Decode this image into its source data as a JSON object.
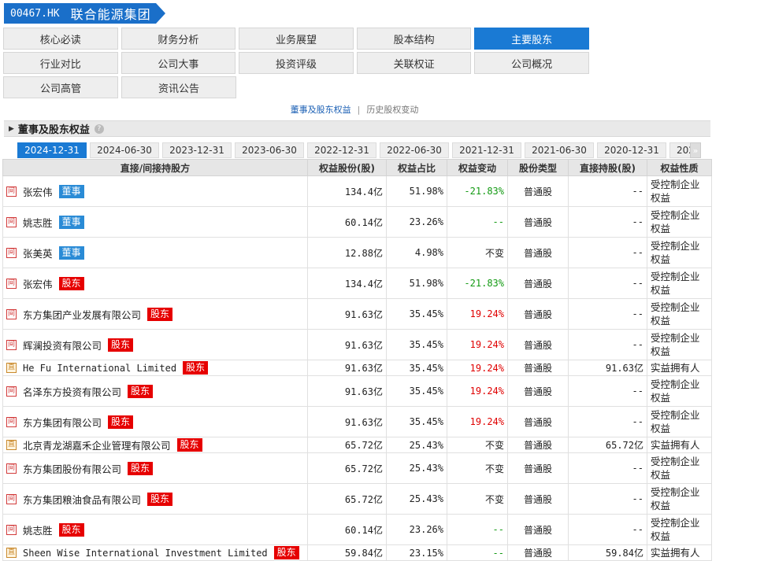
{
  "header": {
    "code": "00467.HK",
    "name": "联合能源集团"
  },
  "nav": [
    [
      {
        "label": "核心必读"
      },
      {
        "label": "财务分析"
      },
      {
        "label": "业务展望"
      },
      {
        "label": "股本结构"
      },
      {
        "label": "主要股东",
        "active": true
      }
    ],
    [
      {
        "label": "行业对比"
      },
      {
        "label": "公司大事"
      },
      {
        "label": "投资评级"
      },
      {
        "label": "关联权证"
      },
      {
        "label": "公司概况"
      }
    ],
    [
      {
        "label": "公司高管"
      },
      {
        "label": "资讯公告"
      }
    ]
  ],
  "sublinks": {
    "link1": "董事及股东权益",
    "sep": "|",
    "link2": "历史股权变动"
  },
  "section": {
    "title": "董事及股东权益",
    "help_icon": "question-circle-icon"
  },
  "dates": [
    "2024-12-31",
    "2024-06-30",
    "2023-12-31",
    "2023-06-30",
    "2022-12-31",
    "2022-06-30",
    "2021-12-31",
    "2021-06-30",
    "2020-12-31",
    "202"
  ],
  "more_arrow": "»",
  "table": {
    "headers": [
      "直接/间接持股方",
      "权益股份(股)",
      "权益占比",
      "权益变动",
      "股份类型",
      "直接持股(股)",
      "权益性质"
    ],
    "rows": [
      {
        "rel": "间",
        "name": "张宏伟",
        "badge": "董事",
        "shares": "134.4亿",
        "pct": "51.98%",
        "change": "-21.83%",
        "type": "普通股",
        "direct": "--",
        "nature": "受控制企业权益"
      },
      {
        "rel": "间",
        "name": "姚志胜",
        "badge": "董事",
        "shares": "60.14亿",
        "pct": "23.26%",
        "change": "--",
        "type": "普通股",
        "direct": "--",
        "nature": "受控制企业权益"
      },
      {
        "rel": "间",
        "name": "张美英",
        "badge": "董事",
        "shares": "12.88亿",
        "pct": "4.98%",
        "change": "不变",
        "type": "普通股",
        "direct": "--",
        "nature": "受控制企业权益"
      },
      {
        "rel": "间",
        "name": "张宏伟",
        "badge": "股东",
        "shares": "134.4亿",
        "pct": "51.98%",
        "change": "-21.83%",
        "type": "普通股",
        "direct": "--",
        "nature": "受控制企业权益"
      },
      {
        "rel": "间",
        "name": "东方集团产业发展有限公司",
        "badge": "股东",
        "shares": "91.63亿",
        "pct": "35.45%",
        "change": "19.24%",
        "type": "普通股",
        "direct": "--",
        "nature": "受控制企业权益"
      },
      {
        "rel": "间",
        "name": "辉澜投资有限公司",
        "badge": "股东",
        "shares": "91.63亿",
        "pct": "35.45%",
        "change": "19.24%",
        "type": "普通股",
        "direct": "--",
        "nature": "受控制企业权益"
      },
      {
        "rel": "直",
        "name": "He Fu International Limited",
        "badge": "股东",
        "shares": "91.63亿",
        "pct": "35.45%",
        "change": "19.24%",
        "type": "普通股",
        "direct": "91.63亿",
        "nature": "实益拥有人"
      },
      {
        "rel": "间",
        "name": "名泽东方投资有限公司",
        "badge": "股东",
        "shares": "91.63亿",
        "pct": "35.45%",
        "change": "19.24%",
        "type": "普通股",
        "direct": "--",
        "nature": "受控制企业权益"
      },
      {
        "rel": "间",
        "name": "东方集团有限公司",
        "badge": "股东",
        "shares": "91.63亿",
        "pct": "35.45%",
        "change": "19.24%",
        "type": "普通股",
        "direct": "--",
        "nature": "受控制企业权益"
      },
      {
        "rel": "直",
        "name": "北京青龙湖嘉禾企业管理有限公司",
        "badge": "股东",
        "shares": "65.72亿",
        "pct": "25.43%",
        "change": "不变",
        "type": "普通股",
        "direct": "65.72亿",
        "nature": "实益拥有人"
      },
      {
        "rel": "间",
        "name": "东方集团股份有限公司",
        "badge": "股东",
        "shares": "65.72亿",
        "pct": "25.43%",
        "change": "不变",
        "type": "普通股",
        "direct": "--",
        "nature": "受控制企业权益"
      },
      {
        "rel": "间",
        "name": "东方集团粮油食品有限公司",
        "badge": "股东",
        "shares": "65.72亿",
        "pct": "25.43%",
        "change": "不变",
        "type": "普通股",
        "direct": "--",
        "nature": "受控制企业权益"
      },
      {
        "rel": "间",
        "name": "姚志胜",
        "badge": "股东",
        "shares": "60.14亿",
        "pct": "23.26%",
        "change": "--",
        "type": "普通股",
        "direct": "--",
        "nature": "受控制企业权益"
      },
      {
        "rel": "直",
        "name": "Sheen Wise International Investment Limited",
        "badge": "股东",
        "shares": "59.84亿",
        "pct": "23.15%",
        "change": "--",
        "type": "普通股",
        "direct": "59.84亿",
        "nature": "实益拥有人"
      }
    ]
  }
}
